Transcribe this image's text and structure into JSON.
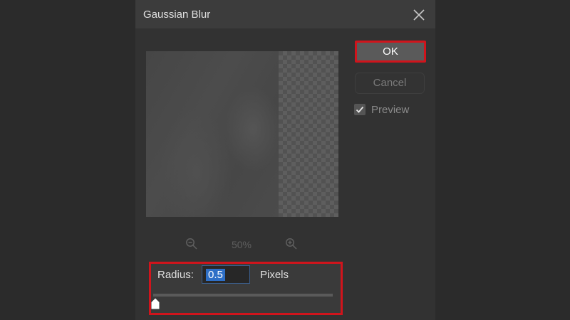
{
  "dialog": {
    "title": "Gaussian Blur",
    "close_icon": "close-icon"
  },
  "buttons": {
    "ok_label": "OK",
    "cancel_label": "Cancel"
  },
  "preview_option": {
    "label": "Preview",
    "checked": true
  },
  "zoom": {
    "level": "50%",
    "zoom_out_icon": "zoom-out-icon",
    "zoom_in_icon": "zoom-in-icon"
  },
  "radius": {
    "label": "Radius:",
    "value": "0.5",
    "unit": "Pixels",
    "slider_fraction": 0.0
  },
  "colors": {
    "highlight": "#d0141c",
    "selection": "#2e6fc7"
  }
}
